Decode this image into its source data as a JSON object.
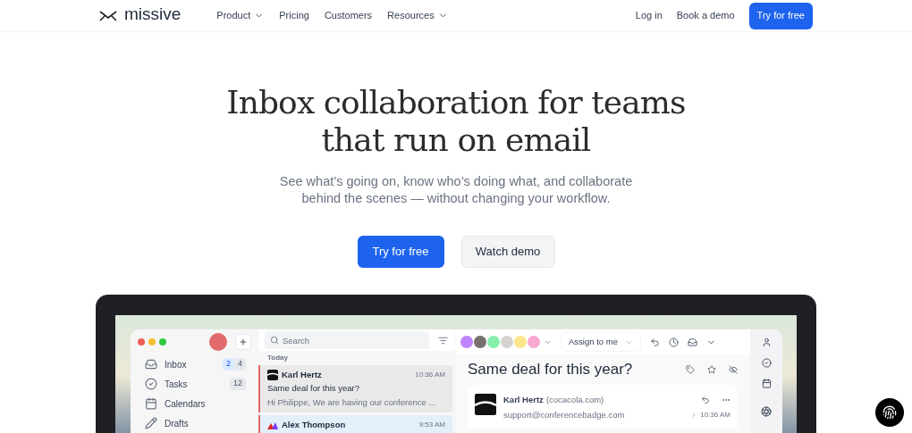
{
  "nav": {
    "logo": "missive",
    "links": [
      {
        "label": "Product",
        "has_menu": true
      },
      {
        "label": "Pricing",
        "has_menu": false
      },
      {
        "label": "Customers",
        "has_menu": false
      },
      {
        "label": "Resources",
        "has_menu": true
      }
    ],
    "login": "Log in",
    "book_demo": "Book a demo",
    "cta": "Try for free"
  },
  "hero": {
    "title_lines": [
      "Inbox collaboration for teams",
      "that run on email"
    ],
    "subtitle_lines": [
      "See what’s going on, know who’s doing what, and collaborate",
      "behind the scenes — without changing your workflow."
    ],
    "primary_button": "Try for free",
    "secondary_button": "Watch demo"
  },
  "app": {
    "sidebar": [
      {
        "label": "Inbox",
        "badges": [
          {
            "text": "2",
            "kind": "new"
          },
          {
            "text": "4",
            "kind": "total"
          }
        ]
      },
      {
        "label": "Tasks",
        "badges": [
          {
            "text": "12",
            "kind": "total"
          }
        ]
      },
      {
        "label": "Calendars"
      },
      {
        "label": "Drafts"
      }
    ],
    "search": {
      "placeholder": "Search"
    },
    "section": "Today",
    "messages": [
      {
        "kind": "wave",
        "sender": "Karl Hertz",
        "time": "10:36 AM",
        "subject": "Same deal for this year?",
        "preview": "Hi Philippe, We are having our conference ...",
        "selected": true
      },
      {
        "kind": "peaks",
        "sender": "Alex Thompson",
        "time": "9:53 AM",
        "selected": false
      }
    ],
    "participants": [
      {
        "color": "#c084fc"
      },
      {
        "color": "#78716c"
      },
      {
        "color": "#86efac"
      },
      {
        "color": "#d6d3d1"
      },
      {
        "color": "#fde68a"
      },
      {
        "color": "#f9a8d4"
      }
    ],
    "assign_button": "Assign to me",
    "detail_subject": "Same deal for this year?",
    "email": {
      "sender": "Karl Hertz",
      "domain": "(cocacola.com)",
      "address": "support@conferencebadge.com",
      "time": "10:36 AM"
    }
  }
}
